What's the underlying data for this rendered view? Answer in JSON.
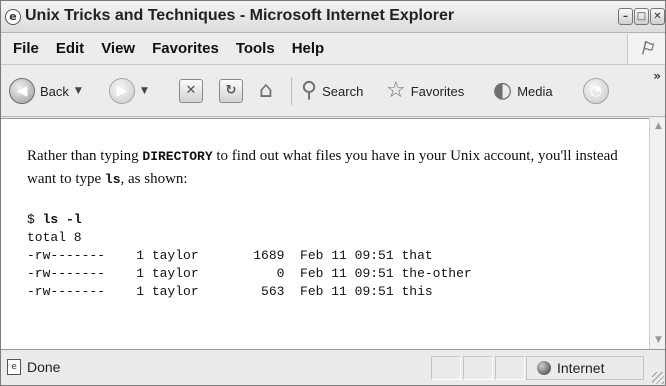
{
  "window": {
    "title": "Unix Tricks and Techniques - Microsoft Internet Explorer",
    "controls": {
      "minimize": "–",
      "maximize": "□",
      "close": "✕"
    }
  },
  "menubar": {
    "items": [
      "File",
      "Edit",
      "View",
      "Favorites",
      "Tools",
      "Help"
    ]
  },
  "toolbar": {
    "back_label": "Back",
    "search_label": "Search",
    "favorites_label": "Favorites",
    "media_label": "Media",
    "overflow": "»"
  },
  "content": {
    "para_text1": "Rather than typing ",
    "para_code1": "DIRECTORY",
    "para_text2": " to find out what files you have in your Unix account, you'll instead want to type ",
    "para_code2": "ls",
    "para_text3": ", as shown:",
    "prompt": "$ ",
    "command": "ls -l",
    "output": [
      "total 8",
      "-rw-------    1 taylor       1689  Feb 11 09:51 that",
      "-rw-------    1 taylor          0  Feb 11 09:51 the-other",
      "-rw-------    1 taylor        563  Feb 11 09:51 this"
    ]
  },
  "statusbar": {
    "status": "Done",
    "zone": "Internet"
  },
  "icons": {
    "back": "arrow-left",
    "forward": "arrow-right",
    "stop": "x",
    "refresh": "refresh",
    "home": "house",
    "search": "magnifier",
    "favorites": "star",
    "media": "speaker",
    "history": "clock",
    "ie_logo": "windows-flag"
  }
}
